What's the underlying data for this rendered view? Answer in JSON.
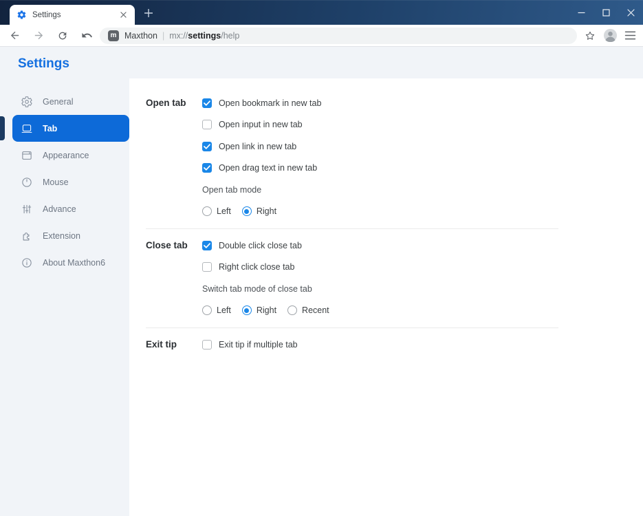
{
  "window": {
    "tab": {
      "title": "Settings",
      "favicon": "gear-icon"
    },
    "new_tab_glyph": "+",
    "controls": [
      {
        "name": "minimize",
        "icon": "minimize-icon"
      },
      {
        "name": "maximize",
        "icon": "maximize-icon"
      },
      {
        "name": "close",
        "icon": "close-icon"
      }
    ]
  },
  "toolbar": {
    "nav_icons": [
      "back-icon",
      "forward-icon",
      "refresh-icon",
      "undo-icon"
    ],
    "url": {
      "brand": "Maxthon",
      "separator": "|",
      "scheme": "mx://",
      "host": "settings",
      "path": "/help"
    },
    "right_icons": [
      "star-icon",
      "profile-icon",
      "menu-icon"
    ]
  },
  "sidebar": {
    "heading": "Settings",
    "items": [
      {
        "label": "General",
        "icon": "gear-icon",
        "selected": false
      },
      {
        "label": "Tab",
        "icon": "tab-icon",
        "selected": true
      },
      {
        "label": "Appearance",
        "icon": "appearance-icon",
        "selected": false
      },
      {
        "label": "Mouse",
        "icon": "mouse-icon",
        "selected": false
      },
      {
        "label": "Advance",
        "icon": "sliders-icon",
        "selected": false
      },
      {
        "label": "Extension",
        "icon": "puzzle-icon",
        "selected": false
      },
      {
        "label": "About Maxthon6",
        "icon": "info-icon",
        "selected": false
      }
    ]
  },
  "content": {
    "sections": [
      {
        "label": "Open tab",
        "rows": [
          {
            "type": "checkbox",
            "label": "Open bookmark in new tab",
            "checked": true
          },
          {
            "type": "checkbox",
            "label": "Open input in new tab",
            "checked": false
          },
          {
            "type": "checkbox",
            "label": "Open link in new tab",
            "checked": true
          },
          {
            "type": "checkbox",
            "label": "Open drag text in new tab",
            "checked": true
          },
          {
            "type": "text",
            "label": "Open tab mode"
          },
          {
            "type": "radio-group",
            "options": [
              {
                "label": "Left",
                "selected": false
              },
              {
                "label": "Right",
                "selected": true
              }
            ]
          }
        ]
      },
      {
        "label": "Close tab",
        "rows": [
          {
            "type": "checkbox",
            "label": "Double click close tab",
            "checked": true
          },
          {
            "type": "checkbox",
            "label": "Right click close tab",
            "checked": false
          },
          {
            "type": "text",
            "label": "Switch tab mode of close tab"
          },
          {
            "type": "radio-group",
            "options": [
              {
                "label": "Left",
                "selected": false
              },
              {
                "label": "Right",
                "selected": true
              },
              {
                "label": "Recent",
                "selected": false
              }
            ]
          }
        ]
      },
      {
        "label": "Exit tip",
        "rows": [
          {
            "type": "checkbox",
            "label": "Exit tip if multiple tab",
            "checked": false
          }
        ]
      }
    ]
  },
  "colors": {
    "accent_blue": "#1570e0",
    "control_blue": "#1a87e8",
    "selected_item_blue": "#0d6ad8",
    "indicator_navy": "#1b3a61",
    "titlebar_dark": "#12233e",
    "titlebar_light": "#2f5a8a"
  }
}
